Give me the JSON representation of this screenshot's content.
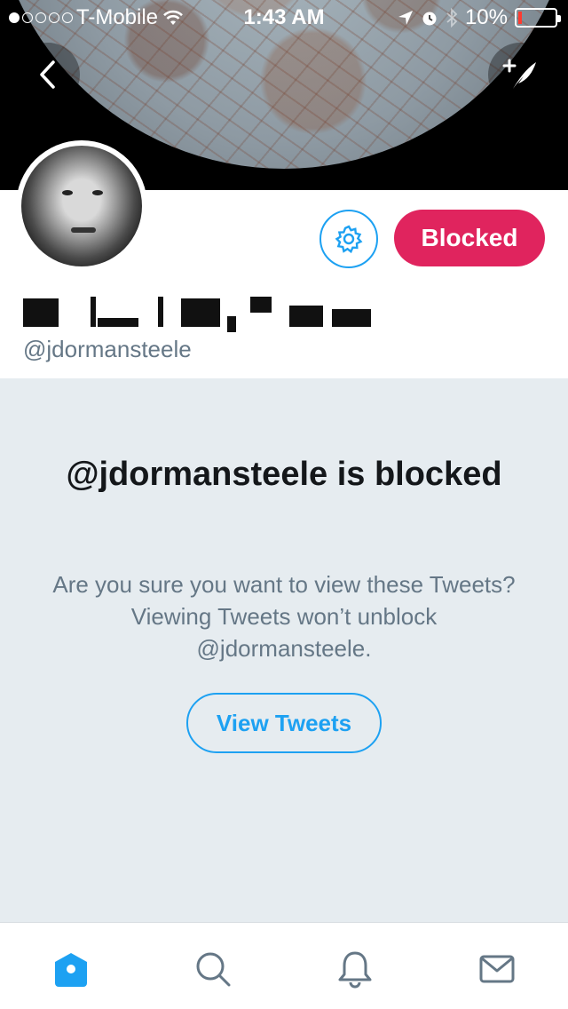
{
  "status_bar": {
    "carrier": "T-Mobile",
    "time": "1:43 AM",
    "battery": "10%",
    "signal_full_dots": 1,
    "signal_total_dots": 5
  },
  "header": {
    "back_icon": "chevron-left-icon",
    "compose_icon": "compose-tweet-icon"
  },
  "profile": {
    "handle": "@jdormansteele",
    "settings_icon": "gear-icon",
    "blocked_label": "Blocked"
  },
  "blocked_notice": {
    "title": "@jdormansteele is blocked",
    "description": "Are you sure you want to view these Tweets? Viewing Tweets won’t unblock @jdormansteele.",
    "view_button": "View Tweets"
  },
  "tab_bar": {
    "items": [
      {
        "name": "home",
        "icon": "home-icon",
        "active": true
      },
      {
        "name": "search",
        "icon": "search-icon",
        "active": false
      },
      {
        "name": "notifications",
        "icon": "bell-icon",
        "active": false
      },
      {
        "name": "messages",
        "icon": "envelope-icon",
        "active": false
      }
    ]
  },
  "colors": {
    "accent": "#1da1f2",
    "blocked": "#e0245e",
    "muted_text": "#657786",
    "panel_bg": "#e6ecf0"
  }
}
